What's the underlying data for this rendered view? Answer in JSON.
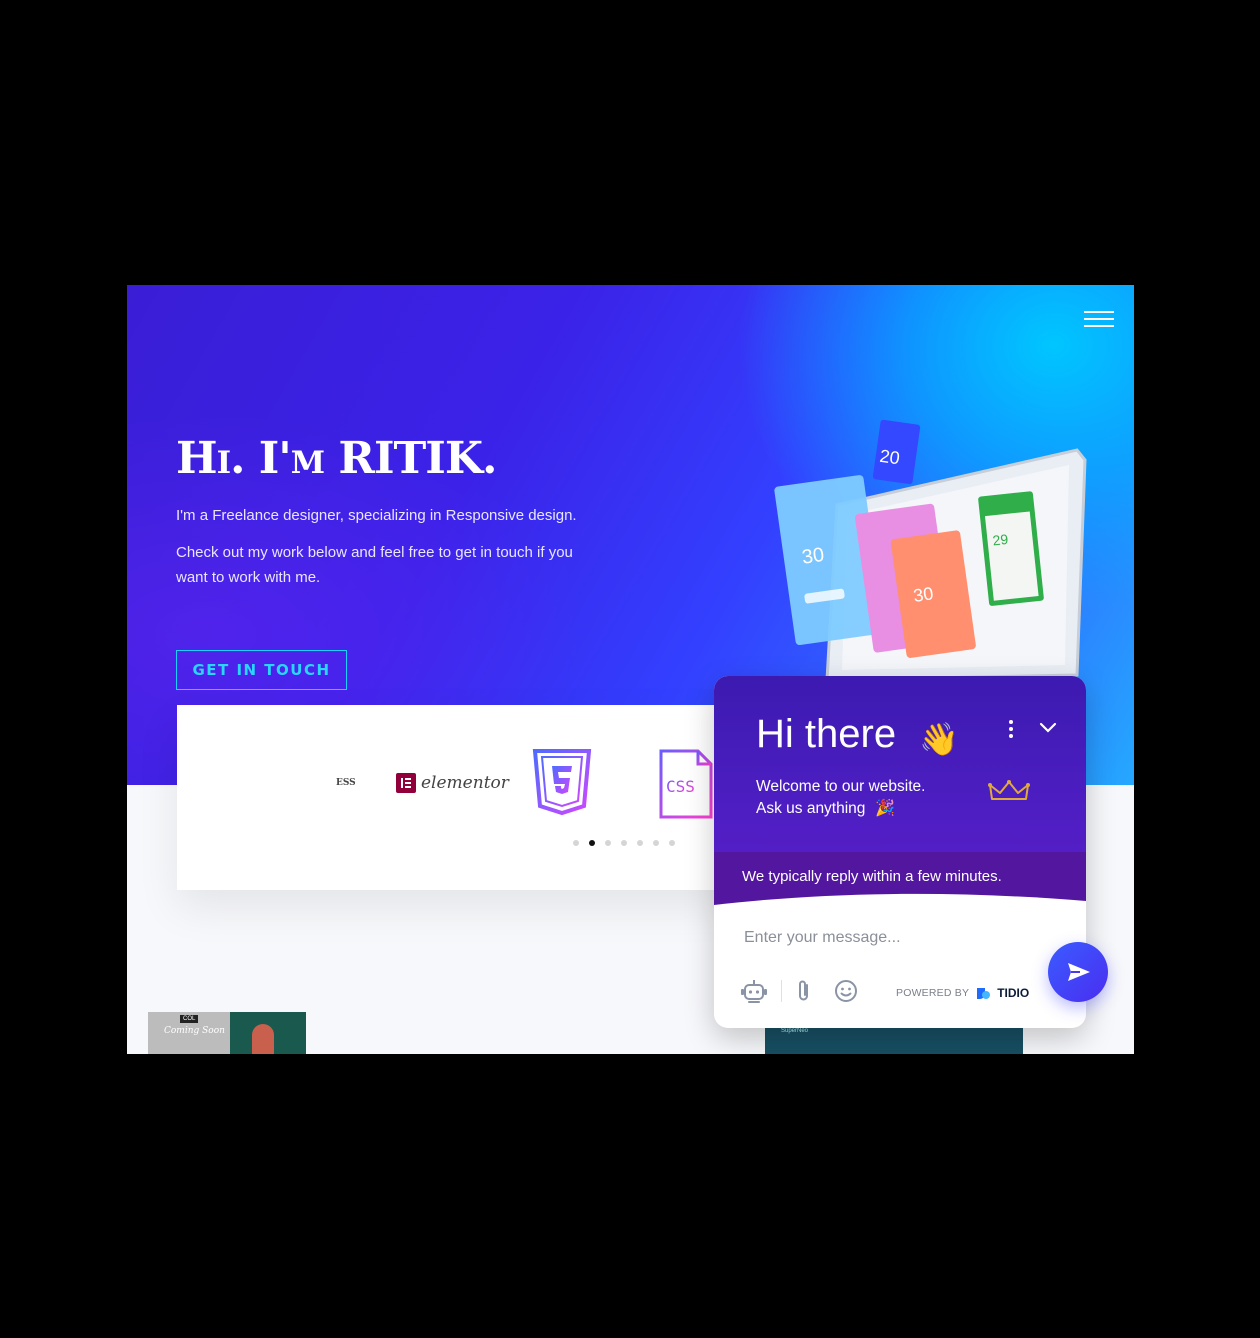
{
  "hero": {
    "title": "Hi. I'm RITIK.",
    "subtitle": "I'm a Freelance designer, specializing in Responsive design.",
    "text": "Check out my work below and feel free to get in touch if you want to work with me.",
    "cta_label": "GET IN TOUCH"
  },
  "nav": {
    "menu_icon": "hamburger-icon"
  },
  "logos": {
    "items": [
      {
        "name": "ess-logo",
        "text": "ESS"
      },
      {
        "name": "elementor-logo",
        "text": "elementor"
      },
      {
        "name": "html5-icon"
      },
      {
        "name": "css-icon",
        "text": "CSS"
      }
    ],
    "dots_count": 7,
    "active_dot": 1
  },
  "thumbs": {
    "thumb1_badge": "COL",
    "thumb1_title": "Coming Soon",
    "thumb2_title": "SuperNeo"
  },
  "chat": {
    "title": "Hi there",
    "wave_emoji": "👋",
    "welcome": "Welcome to our website.",
    "ask": "Ask us anything",
    "party_emoji": "🎉",
    "reply_time": "We typically reply within a few minutes.",
    "input_placeholder": "Enter your message...",
    "powered_by": "POWERED BY",
    "brand": "TIDIO"
  },
  "colors": {
    "hero_start": "#3a1ed6",
    "hero_end": "#00c6ff",
    "cta": "#19d3ff",
    "chat_header": "#4e1ec3",
    "send_button": "#3a5cff"
  }
}
